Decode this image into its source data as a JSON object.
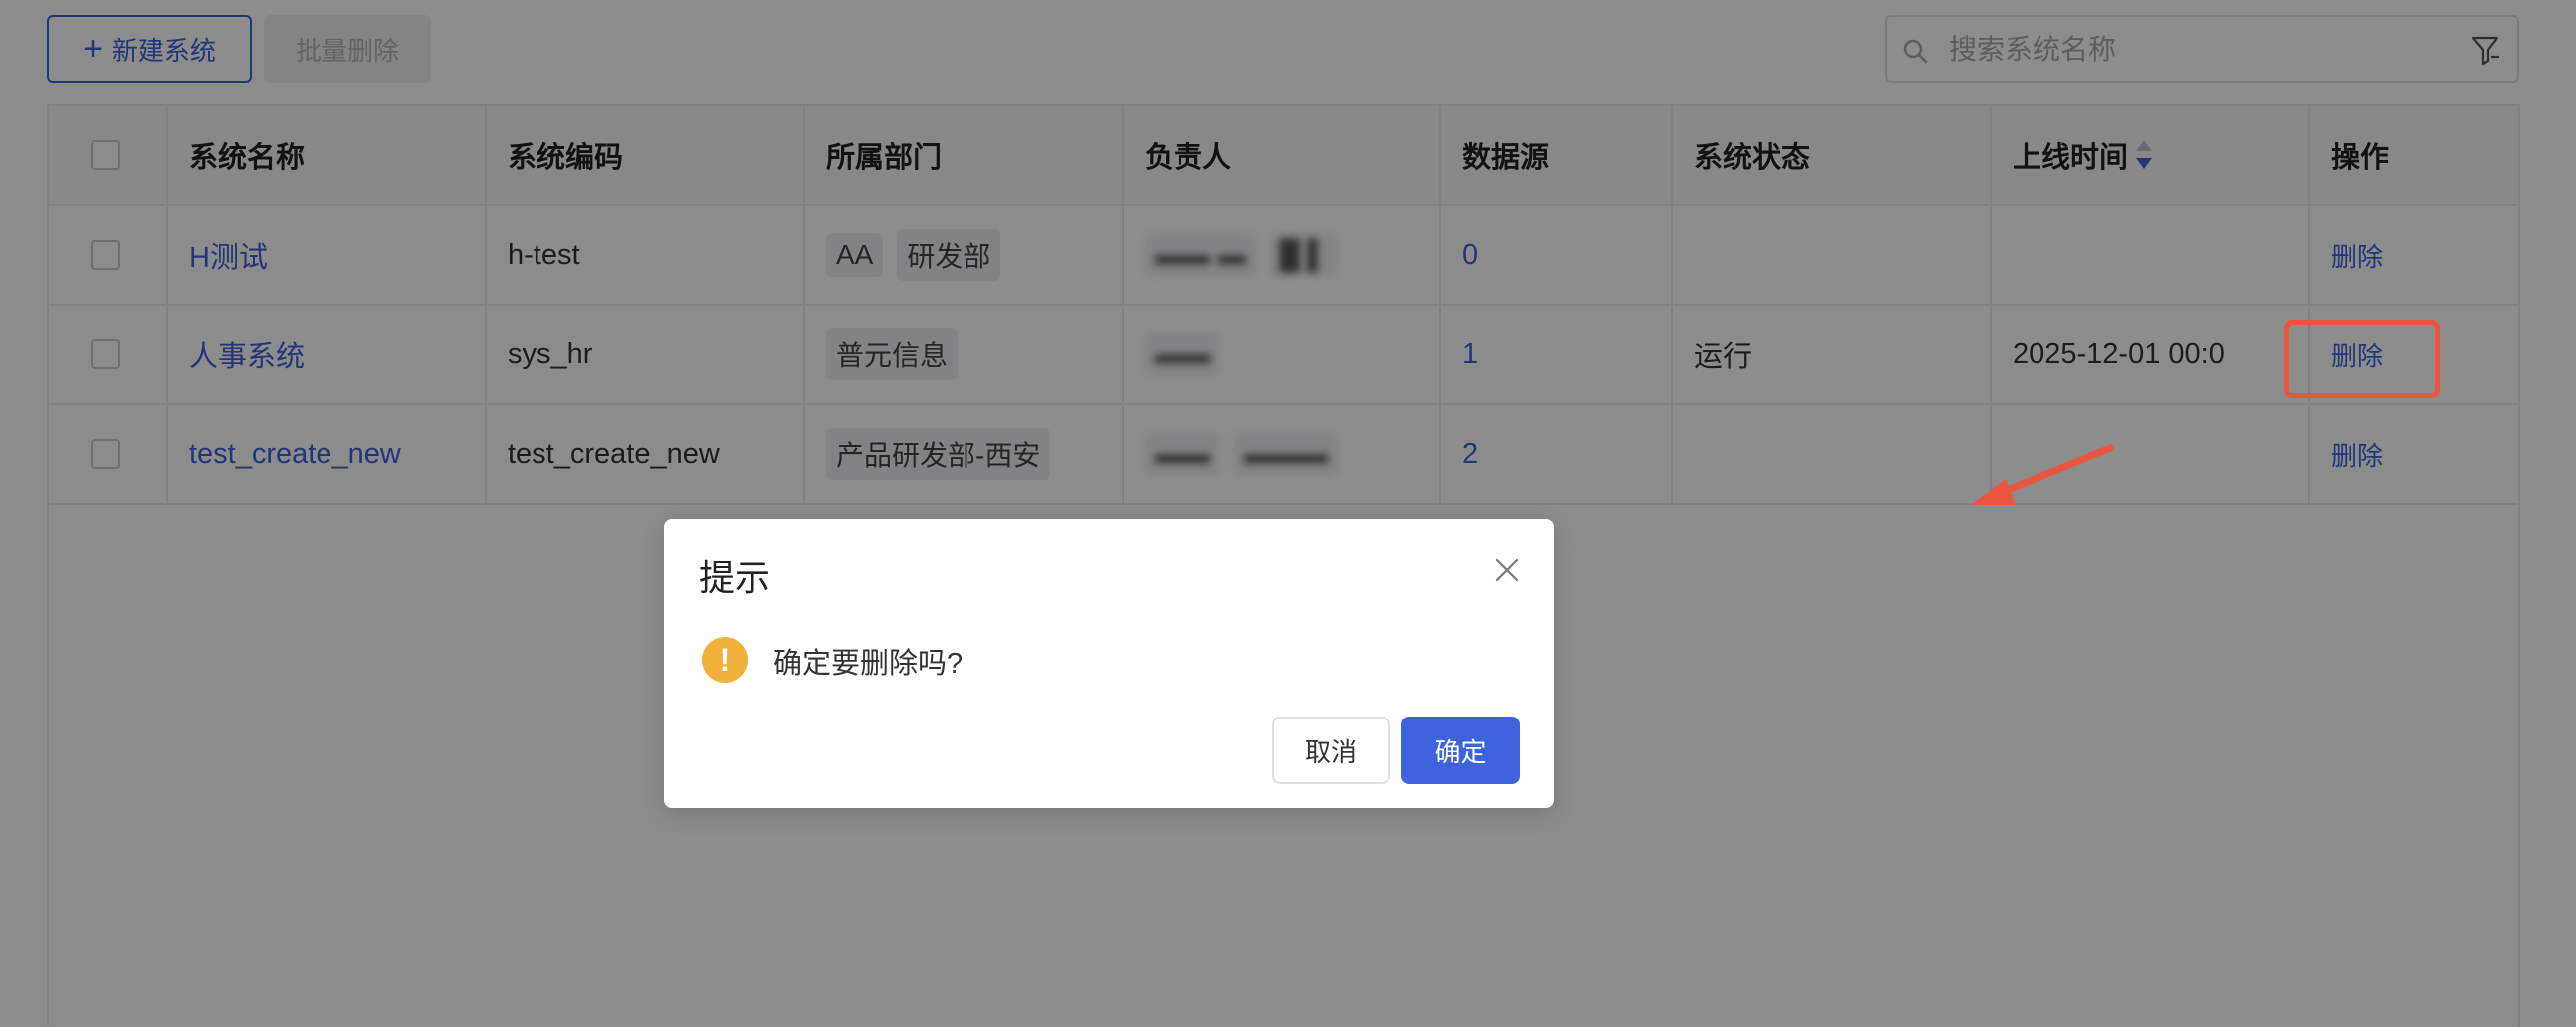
{
  "toolbar": {
    "new_label": "新建系统",
    "batch_delete_label": "批量删除",
    "search_placeholder": "搜索系统名称"
  },
  "table": {
    "headers": {
      "name": "系统名称",
      "code": "系统编码",
      "dept": "所属部门",
      "owner": "负责人",
      "datasource": "数据源",
      "status": "系统状态",
      "online_time": "上线时间",
      "action": "操作"
    },
    "rows": [
      {
        "name": "H测试",
        "code": "h-test",
        "depts": [
          "AA",
          "研发部"
        ],
        "owners": [
          "▬▬ ▬",
          "█ ▌"
        ],
        "datasource": "0",
        "status": "",
        "online_time": "",
        "action": "删除"
      },
      {
        "name": "人事系统",
        "code": "sys_hr",
        "depts": [
          "普元信息"
        ],
        "owners": [
          "▬▬"
        ],
        "datasource": "1",
        "status": "运行",
        "online_time": "2025-12-01 00:0",
        "action": "删除"
      },
      {
        "name": "test_create_new",
        "code": "test_create_new",
        "depts": [
          "产品研发部-西安"
        ],
        "owners": [
          "▬▬",
          "▬▬▬"
        ],
        "datasource": "2",
        "status": "",
        "online_time": "",
        "action": "删除"
      }
    ]
  },
  "dialog": {
    "title": "提示",
    "message": "确定要删除吗?",
    "cancel_label": "取消",
    "ok_label": "确定"
  },
  "colors": {
    "primary": "#3d63dd",
    "warning": "#f0b23b",
    "annotation": "#e9553f"
  }
}
